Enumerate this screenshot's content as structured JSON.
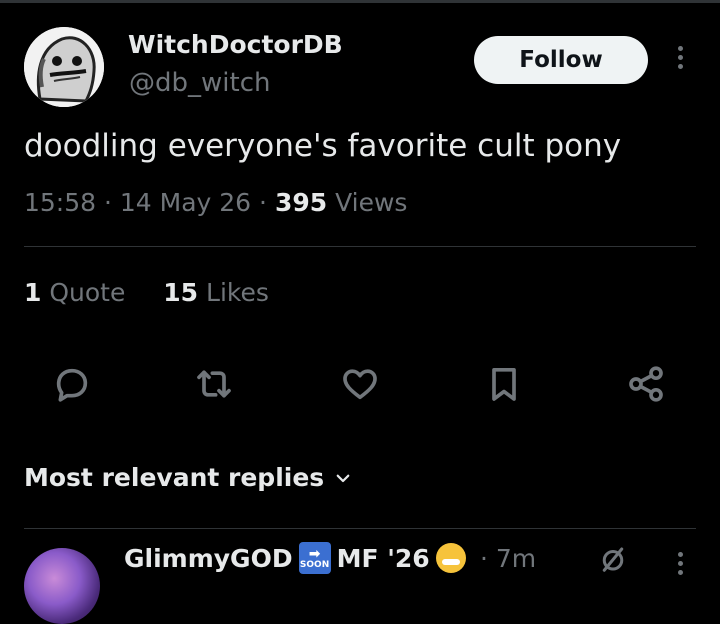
{
  "tweet": {
    "author_name": "WitchDoctorDB",
    "author_handle": "@db_witch",
    "follow_label": "Follow",
    "text": "doodling everyone's favorite cult pony",
    "time": "15:58",
    "sep1": " · ",
    "date": "14 May 26",
    "sep2": " · ",
    "views_count": "395",
    "views_label": " Views",
    "quotes_count": "1",
    "quotes_label": "Quote",
    "likes_count": "15",
    "likes_label": "Likes"
  },
  "actions": {
    "icons": [
      "reply-icon",
      "retweet-icon",
      "like-icon",
      "bookmark-icon",
      "share-icon"
    ]
  },
  "replies": {
    "sort_label": "Most relevant replies"
  },
  "reply": {
    "author_name_a": "GlimmyGOD",
    "badge_text": "SOON",
    "author_name_b": "MF '26",
    "sep": "·",
    "time": "7m"
  },
  "colors": {
    "background": "#000000",
    "text_primary": "#e7e9ea",
    "text_secondary": "#71767b",
    "divider": "#2f3336",
    "follow_bg": "#eff3f4"
  }
}
